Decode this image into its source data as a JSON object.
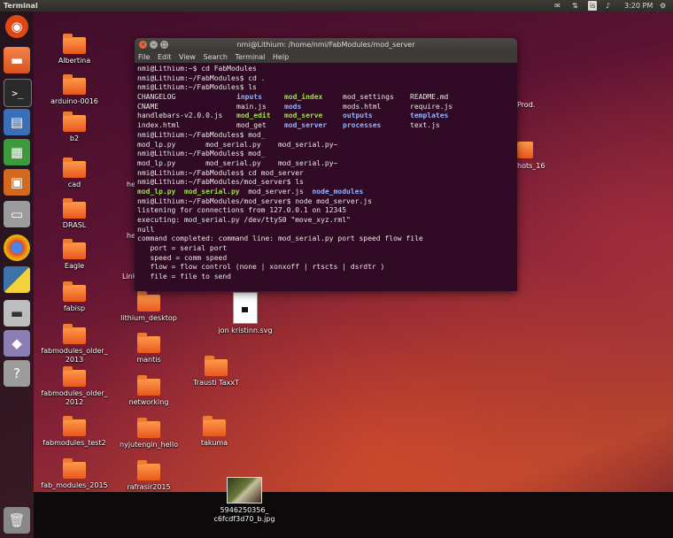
{
  "panel": {
    "title": "Terminal",
    "clock": "3:20 PM",
    "keyboard_badge": "is"
  },
  "terminal": {
    "title": "nmi@Lithium: /home/nmi/FabModules/mod_server",
    "menu": [
      "File",
      "Edit",
      "View",
      "Search",
      "Terminal",
      "Help"
    ],
    "lines": [
      "nmi@Lithium:~$ cd FabModules",
      "nmi@Lithium:~/FabModules$ cd .",
      "nmi@Lithium:~/FabModules$ ls"
    ],
    "ls_rows": [
      [
        {
          "t": "CHANGELOG",
          "c": ""
        },
        {
          "t": "inputs",
          "c": "blue"
        },
        {
          "t": "mod_index",
          "c": "green"
        },
        {
          "t": "mod_settings",
          "c": ""
        },
        {
          "t": "README.md",
          "c": ""
        }
      ],
      [
        {
          "t": "CNAME",
          "c": ""
        },
        {
          "t": "main.js",
          "c": ""
        },
        {
          "t": "mods",
          "c": "blue"
        },
        {
          "t": "mods.html",
          "c": ""
        },
        {
          "t": "require.js",
          "c": ""
        }
      ],
      [
        {
          "t": "handlebars-v2.0.0.js",
          "c": ""
        },
        {
          "t": "mod_edit",
          "c": "green"
        },
        {
          "t": "mod_serve",
          "c": "green"
        },
        {
          "t": "outputs",
          "c": "blue"
        },
        {
          "t": "templates",
          "c": "blue"
        }
      ],
      [
        {
          "t": "index.html",
          "c": ""
        },
        {
          "t": "mod_get",
          "c": ""
        },
        {
          "t": "mod_server",
          "c": "blue"
        },
        {
          "t": "processes",
          "c": "blue"
        },
        {
          "t": "text.js",
          "c": ""
        }
      ]
    ],
    "lines2": [
      "nmi@Lithium:~/FabModules$ mod_",
      "mod_lp.py       mod_serial.py    mod_serial.py~",
      "nmi@Lithium:~/FabModules$ mod_",
      "mod_lp.py       mod_serial.py    mod_serial.py~",
      "nmi@Lithium:~/FabModules$ cd mod_server",
      "nmi@Lithium:~/FabModules/mod_server$ ls"
    ],
    "ls2": [
      {
        "t": "mod_lp.py",
        "c": "green"
      },
      {
        "t": "mod_serial.py",
        "c": "green"
      },
      {
        "t": "mod_server.js",
        "c": ""
      },
      {
        "t": "node_modules",
        "c": "blue"
      }
    ],
    "lines3": [
      "nmi@Lithium:~/FabModules/mod_server$ node mod_server.js",
      "listening for connections from 127.0.0.1 on 12345",
      "executing: mod_serial.py /dev/ttyS0 \"move_xyz.rml\"",
      "null",
      "command completed: command line: mod_serial.py port speed flow file",
      "   port = serial port",
      "   speed = comm speed",
      "   flow = flow control (none | xonxoff | rtscts | dsrdtr )",
      "   file = file to send"
    ]
  },
  "desktop_icons": [
    {
      "label": "Albertina"
    },
    {
      "label": "arduino-0016"
    },
    {
      "label": "b2"
    },
    {
      "label": "cad"
    },
    {
      "label": "DRASL"
    },
    {
      "label": "Eagle"
    },
    {
      "label": "fabisp"
    },
    {
      "label": "fabmodules_older_\n2013"
    },
    {
      "label": "fabmodules_older_\n2012"
    },
    {
      "label": "fabmodules_test2"
    },
    {
      "label": "fab_modules_2015"
    },
    {
      "label": "lithium_desktop"
    },
    {
      "label": "mantis"
    },
    {
      "label": "networking"
    },
    {
      "label": "nyjutengin_hello"
    },
    {
      "label": "rafrasir2015"
    },
    {
      "label": "Trausti TaxxT"
    },
    {
      "label": "takuma"
    },
    {
      "label": "jon kristinn.svg"
    },
    {
      "label": "5946250356_\nc6fcdf3d70_b.jpg"
    }
  ],
  "partial_labels": [
    "he",
    "he",
    "Link",
    "Prod.",
    "hots_16"
  ],
  "launcher_items": [
    {
      "name": "ubuntu-dash-icon"
    },
    {
      "name": "files-icon"
    },
    {
      "name": "terminal-icon"
    },
    {
      "name": "writer-icon"
    },
    {
      "name": "calc-icon"
    },
    {
      "name": "impress-icon"
    },
    {
      "name": "archive-icon"
    },
    {
      "name": "chrome-icon"
    },
    {
      "name": "python-icon"
    },
    {
      "name": "drive-icon"
    },
    {
      "name": "inkscape-icon"
    },
    {
      "name": "help-icon"
    },
    {
      "name": "trash-icon"
    }
  ]
}
